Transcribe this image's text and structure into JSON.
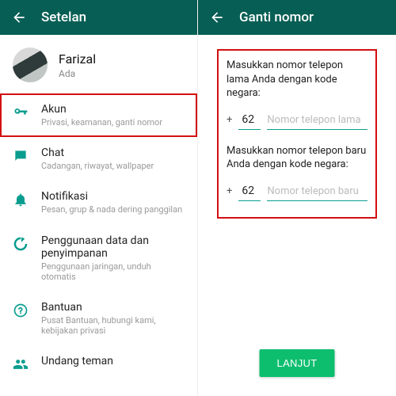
{
  "left": {
    "header_title": "Setelan",
    "profile": {
      "name": "Farizal",
      "status": "Ada"
    },
    "items": [
      {
        "label": "Akun",
        "sub": "Privasi, keamanan, ganti nomor"
      },
      {
        "label": "Chat",
        "sub": "Cadangan, riwayat, wallpaper"
      },
      {
        "label": "Notifikasi",
        "sub": "Pesan, grup & nada dering panggilan"
      },
      {
        "label": "Penggunaan data dan penyimpanan",
        "sub": "Penggunaan jaringan, unduh otomatis"
      },
      {
        "label": "Bantuan",
        "sub": "Pusat Bantuan, hubungi kami, kebijakan privasi"
      },
      {
        "label": "Undang teman",
        "sub": ""
      }
    ]
  },
  "right": {
    "header_title": "Ganti nomor",
    "prompt_old": "Masukkan nomor telepon lama Anda dengan kode negara:",
    "prompt_new": "Masukkan nomor telepon baru Anda dengan kode negara:",
    "plus": "+",
    "cc": "62",
    "placeholder_old": "Nomor telepon lama",
    "placeholder_new": "Nomor telepon baru",
    "button": "LANJUT"
  }
}
